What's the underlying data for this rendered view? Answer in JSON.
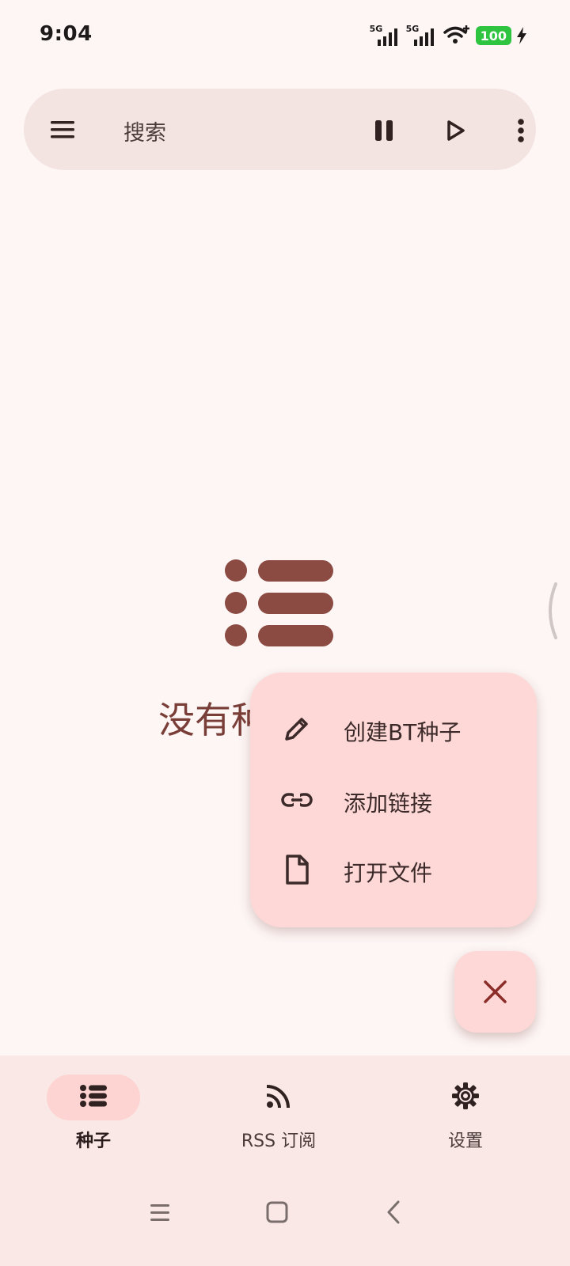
{
  "status_bar": {
    "time": "9:04",
    "signal1_label": "5G",
    "signal2_label": "5G",
    "battery": "100"
  },
  "search_bar": {
    "label": "搜索",
    "menu_icon": "menu-icon",
    "pause_icon": "pause-icon",
    "resume_icon": "play-icon",
    "more_icon": "more-vert-icon"
  },
  "empty_state": {
    "icon": "list-icon",
    "text": "没有种子"
  },
  "fab_menu": {
    "items": [
      {
        "label": "创建BT种子",
        "icon": "pencil-icon"
      },
      {
        "label": "添加链接",
        "icon": "link-icon"
      },
      {
        "label": "打开文件",
        "icon": "file-icon"
      }
    ],
    "close_icon": "close-icon"
  },
  "bottom_nav": {
    "items": [
      {
        "label": "种子",
        "icon": "list-icon",
        "active": true
      },
      {
        "label": "RSS 订阅",
        "icon": "rss-icon",
        "active": false
      },
      {
        "label": "设置",
        "icon": "gear-icon",
        "active": false
      }
    ]
  },
  "colors": {
    "background": "#fdf6f5",
    "accent": "#8b4a42",
    "fab": "#fdd8d6",
    "search_bar": "#f4e4e1",
    "battery": "#2ec440"
  }
}
